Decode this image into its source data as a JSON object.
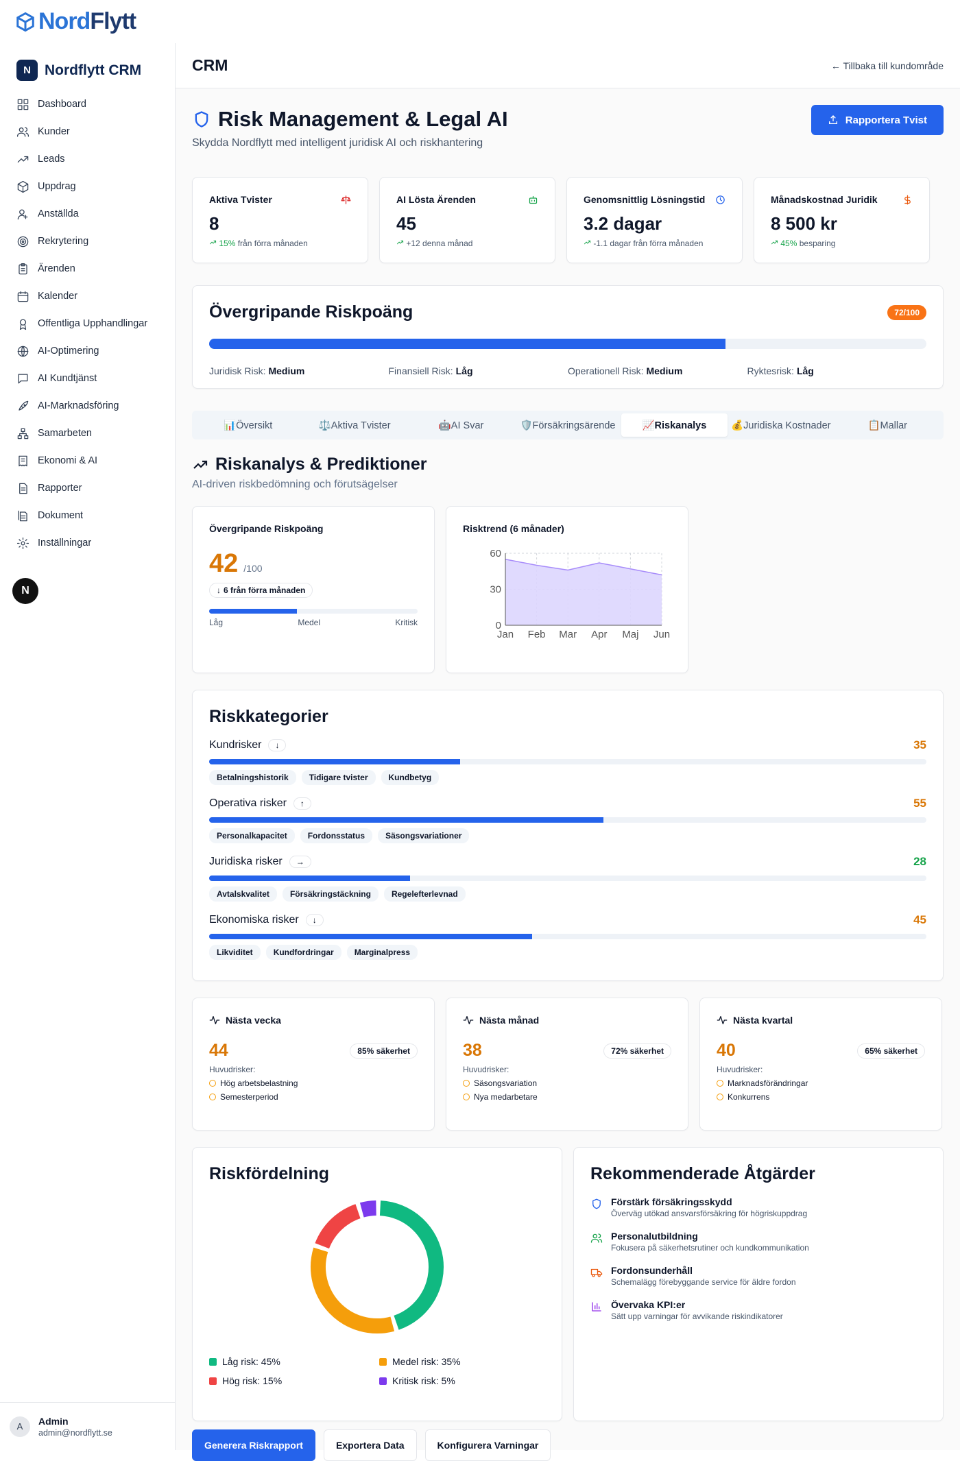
{
  "logo": {
    "part1": "Nord",
    "part2": "Flytt"
  },
  "sidebar": {
    "brand_badge": "N",
    "brand_title": "Nordflytt CRM",
    "items": [
      {
        "label": "Dashboard",
        "icon": "grid-icon"
      },
      {
        "label": "Kunder",
        "icon": "users-icon"
      },
      {
        "label": "Leads",
        "icon": "trending-up-icon"
      },
      {
        "label": "Uppdrag",
        "icon": "package-icon"
      },
      {
        "label": "Anställda",
        "icon": "user-icon"
      },
      {
        "label": "Rekrytering",
        "icon": "target-icon"
      },
      {
        "label": "Ärenden",
        "icon": "clipboard-icon"
      },
      {
        "label": "Kalender",
        "icon": "calendar-icon"
      },
      {
        "label": "Offentliga Upphandlingar",
        "icon": "award-icon"
      },
      {
        "label": "AI-Optimering",
        "icon": "globe-icon"
      },
      {
        "label": "AI Kundtjänst",
        "icon": "message-icon"
      },
      {
        "label": "AI-Marknadsföring",
        "icon": "rocket-icon"
      },
      {
        "label": "Samarbeten",
        "icon": "network-icon"
      },
      {
        "label": "Ekonomi & AI",
        "icon": "receipt-icon"
      },
      {
        "label": "Rapporter",
        "icon": "file-icon"
      },
      {
        "label": "Dokument",
        "icon": "files-icon"
      },
      {
        "label": "Inställningar",
        "icon": "gear-icon"
      }
    ],
    "floating_badge": "N",
    "user": {
      "avatar": "A",
      "name": "Admin",
      "email": "admin@nordflytt.se"
    }
  },
  "header": {
    "title": "CRM",
    "back_link": "← Tillbaka till kundområde"
  },
  "page": {
    "title": "Risk Management & Legal AI",
    "subtitle": "Skydda Nordflytt med intelligent juridisk AI och riskhantering",
    "report_button": "Rapportera Tvist"
  },
  "stats": [
    {
      "title": "Aktiva Tvister",
      "value": "8",
      "change_hi": "15%",
      "change": "från förra månaden",
      "icon": "scale-icon",
      "icon_color": "#dc2626"
    },
    {
      "title": "AI Lösta Ärenden",
      "value": "45",
      "change_hi": "",
      "change": "+12 denna månad",
      "icon": "bot-icon",
      "icon_color": "#16a34a"
    },
    {
      "title": "Genomsnittlig Lösningstid",
      "value": "3.2 dagar",
      "change_hi": "",
      "change": "-1.1 dagar från förra månaden",
      "icon": "clock-icon",
      "icon_color": "#2563eb"
    },
    {
      "title": "Månadskostnad Juridik",
      "value": "8 500 kr",
      "change_hi": "45%",
      "change": "besparing",
      "icon": "dollar-icon",
      "icon_color": "#ea580c"
    }
  ],
  "overall": {
    "title": "Övergripande Riskpoäng",
    "badge": "72/100",
    "progress": 0.72,
    "items": [
      {
        "label": "Juridisk Risk:",
        "value": "Medium"
      },
      {
        "label": "Finansiell Risk:",
        "value": "Låg"
      },
      {
        "label": "Operationell Risk:",
        "value": "Medium"
      },
      {
        "label": "Ryktesrisk:",
        "value": "Låg"
      }
    ]
  },
  "tabs": [
    {
      "label": "📊Översikt",
      "active": false
    },
    {
      "label": "⚖️Aktiva Tvister",
      "active": false
    },
    {
      "label": "🤖AI Svar",
      "active": false
    },
    {
      "label": "🛡️Försäkringsärende",
      "active": false
    },
    {
      "label": "📈Riskanalys",
      "active": true
    },
    {
      "label": "💰Juridiska Kostnader",
      "active": false
    },
    {
      "label": "📋Mallar",
      "active": false
    }
  ],
  "analysis": {
    "title": "Riskanalys & Prediktioner",
    "subtitle": "AI-driven riskbedömning och förutsägelser",
    "score_card": {
      "title": "Övergripande Riskpoäng",
      "value": "42",
      "max": "/100",
      "change": "6 från förra månaden",
      "progress": 0.42,
      "scale": [
        "Låg",
        "Medel",
        "Kritisk"
      ]
    },
    "trend_title": "Risktrend (6 månader)"
  },
  "chart_data": {
    "type": "area",
    "title": "Risktrend (6 månader)",
    "categories": [
      "Jan",
      "Feb",
      "Mar",
      "Apr",
      "Maj",
      "Jun"
    ],
    "values": [
      55,
      50,
      46,
      52,
      47,
      42
    ],
    "ylim": [
      0,
      60
    ],
    "yticks": [
      "0",
      "30",
      "60"
    ],
    "grid": true,
    "color": "#a78bfa"
  },
  "categories": {
    "title": "Riskkategorier",
    "items": [
      {
        "name": "Kundrisker",
        "trend": "↓",
        "score": "35",
        "fraction": 0.35,
        "score_color": "#d97706",
        "tags": [
          "Betalningshistorik",
          "Tidigare tvister",
          "Kundbetyg"
        ]
      },
      {
        "name": "Operativa risker",
        "trend": "↑",
        "score": "55",
        "fraction": 0.55,
        "score_color": "#d97706",
        "tags": [
          "Personalkapacitet",
          "Fordonsstatus",
          "Säsongsvariationer"
        ]
      },
      {
        "name": "Juridiska risker",
        "trend": "→",
        "score": "28",
        "fraction": 0.28,
        "score_color": "#16a34a",
        "tags": [
          "Avtalskvalitet",
          "Försäkringstäckning",
          "Regelefterlevnad"
        ]
      },
      {
        "name": "Ekonomiska risker",
        "trend": "↓",
        "score": "45",
        "fraction": 0.45,
        "score_color": "#d97706",
        "tags": [
          "Likviditet",
          "Kundfordringar",
          "Marginalpress"
        ]
      }
    ]
  },
  "predictions": [
    {
      "title": "Nästa vecka",
      "value": "44",
      "confidence": "85% säkerhet",
      "label": "Huvudrisker:",
      "risks": [
        "Hög arbetsbelastning",
        "Semesterperiod"
      ]
    },
    {
      "title": "Nästa månad",
      "value": "38",
      "confidence": "72% säkerhet",
      "label": "Huvudrisker:",
      "risks": [
        "Säsongsvariation",
        "Nya medarbetare"
      ]
    },
    {
      "title": "Nästa kvartal",
      "value": "40",
      "confidence": "65% säkerhet",
      "label": "Huvudrisker:",
      "risks": [
        "Marknadsförändringar",
        "Konkurrens"
      ]
    }
  ],
  "distribution": {
    "title": "Riskfördelning",
    "slices": [
      {
        "label": "Låg risk: 45%",
        "value": 45,
        "color": "#10b981"
      },
      {
        "label": "Medel risk: 35%",
        "value": 35,
        "color": "#f59e0b"
      },
      {
        "label": "Hög risk: 15%",
        "value": 15,
        "color": "#ef4444"
      },
      {
        "label": "Kritisk risk: 5%",
        "value": 5,
        "color": "#7c3aed"
      }
    ]
  },
  "recommendations": {
    "title": "Rekommenderade Åtgärder",
    "items": [
      {
        "title": "Förstärk försäkringsskydd",
        "desc": "Överväg utökad ansvarsförsäkring för högriskuppdrag",
        "icon": "shield-icon",
        "color": "#2563eb"
      },
      {
        "title": "Personalutbildning",
        "desc": "Fokusera på säkerhetsrutiner och kundkommunikation",
        "icon": "users-icon",
        "color": "#16a34a"
      },
      {
        "title": "Fordonsunderhåll",
        "desc": "Schemalägg förebyggande service för äldre fordon",
        "icon": "truck-icon",
        "color": "#ea580c"
      },
      {
        "title": "Övervaka KPI:er",
        "desc": "Sätt upp varningar för avvikande riskindikatorer",
        "icon": "bar-chart-icon",
        "color": "#9333ea"
      }
    ]
  },
  "actions": [
    "Generera Riskrapport",
    "Exportera Data",
    "Konfigurera Varningar"
  ]
}
